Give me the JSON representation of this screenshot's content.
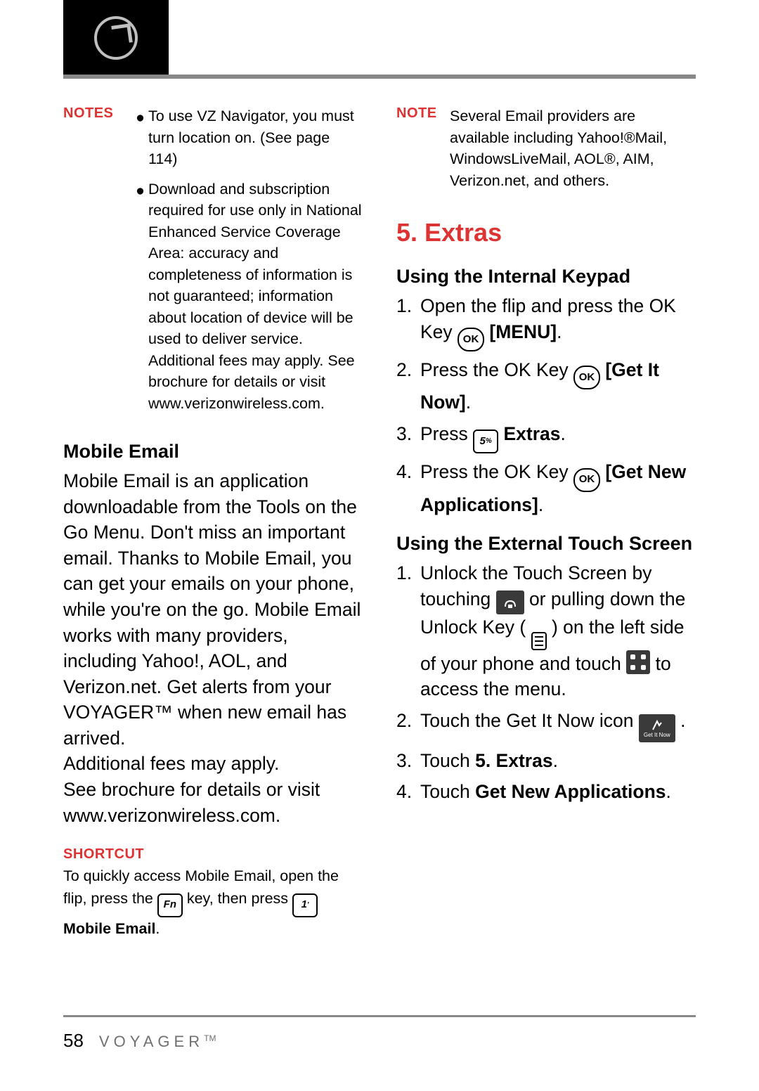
{
  "labels": {
    "notes": "NOTES",
    "note": "NOTE",
    "shortcut": "SHORTCUT",
    "ok": "OK",
    "fn": "Fn",
    "one": "1",
    "five": "5",
    "getitnow": "Get It Now"
  },
  "left": {
    "notes_bullet1": "To use VZ Navigator, you must turn location on. (See page 114)",
    "notes_bullet2": "Download and subscription required for use only in National Enhanced Service Coverage Area: accuracy and completeness of information is not guaranteed; information about location of device will be used to deliver service. Additional fees may apply. See brochure for details or visit www.verizonwireless.com.",
    "mobile_email_h": "Mobile Email",
    "mobile_email_p1": "Mobile Email is an application downloadable from the Tools on the Go Menu. Don't miss an important email. Thanks to Mobile Email, you can get your emails on your phone, while you're on the go. Mobile Email works with many providers, including Yahoo!, AOL, and Verizon.net. Get alerts from your VOYAGER™ when new email has arrived.",
    "mobile_email_p2": "Additional fees may apply.",
    "mobile_email_p3": "See brochure for details or visit www.verizonwireless.com.",
    "shortcut_1a": "To quickly access Mobile Email, open the flip, press the ",
    "shortcut_1b": " key, then press ",
    "shortcut_1c": " Mobile Email",
    "shortcut_1d": "."
  },
  "right": {
    "note_body": "Several Email providers are available including Yahoo!®Mail, WindowsLiveMail, AOL®, AIM, Verizon.net, and others.",
    "extras_h": "5. Extras",
    "keypad_h": "Using the Internal Keypad",
    "k1a": "Open the flip and press the OK Key ",
    "k1b": " [MENU]",
    "k1c": ".",
    "k2a": "Press the OK Key ",
    "k2b": " [Get It Now]",
    "k2c": ".",
    "k3a": "Press ",
    "k3b": " Extras",
    "k3c": ".",
    "k4a": "Press the OK Key ",
    "k4b": " [Get New Applications]",
    "k4c": ".",
    "touch_h": "Using the External Touch Screen",
    "t1a": "Unlock the Touch Screen by touching ",
    "t1b": " or pulling down the Unlock Key ( ",
    "t1c": " ) on the left side of your phone and touch ",
    "t1d": " to access the menu.",
    "t2a": "Touch the Get It Now icon ",
    "t2b": " .",
    "t3a": "Touch ",
    "t3b": "5. Extras",
    "t3c": ".",
    "t4a": "Touch ",
    "t4b": "Get New Applications",
    "t4c": "."
  },
  "footer": {
    "page": "58",
    "brand": "VOYAGER",
    "tm": "TM"
  }
}
